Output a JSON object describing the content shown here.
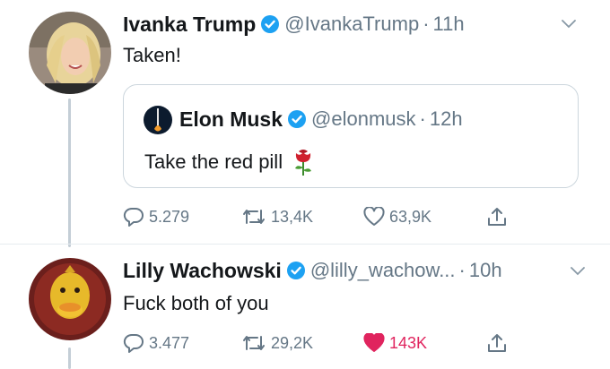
{
  "tweets": [
    {
      "name": "Ivanka Trump",
      "handle": "@IvankaTrump",
      "time": "11h",
      "text": "Taken!",
      "quoted": {
        "name": "Elon Musk",
        "handle": "@elonmusk",
        "time": "12h",
        "text": "Take the red pill"
      },
      "actions": {
        "replies": "5.279",
        "retweets": "13,4K",
        "likes": "63,9K"
      }
    },
    {
      "name": "Lilly Wachowski",
      "handle": "@lilly_wachow...",
      "time": "10h",
      "text": "Fuck both of you",
      "actions": {
        "replies": "3.477",
        "retweets": "29,2K",
        "likes": "143K"
      }
    }
  ],
  "icons": {
    "verified": "verified-badge-icon",
    "reply": "reply-icon",
    "retweet": "retweet-icon",
    "like": "heart-icon",
    "share": "share-icon",
    "menu": "chevron-down-icon",
    "rose": "rose-icon"
  },
  "colors": {
    "verified": "#1da1f2",
    "liked": "#e0245e",
    "muted": "#657786",
    "text": "#14171a"
  }
}
